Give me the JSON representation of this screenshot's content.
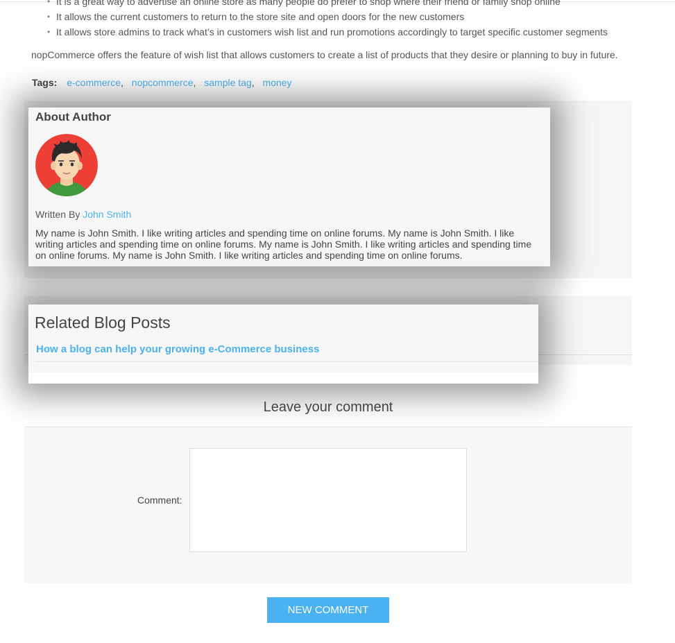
{
  "article": {
    "bullets": [
      "It is a great way to advertise an online store as many people do prefer to shop where their friend or family shop online",
      "It allows the current customers to return to the store site and open doors for the new customers",
      "It allows store admins to track what’s in customers wish list and run promotions accordingly to target specific customer segments"
    ],
    "intro": "nopCommerce offers the feature of wish list that allows customers to create a list of products that they desire or planning to buy in future."
  },
  "tags": {
    "label": "Tags:",
    "items": [
      "e-commerce",
      "nopcommerce",
      "sample tag",
      "money"
    ],
    "separator": ","
  },
  "author": {
    "title": "About Author",
    "written_by": "Written By",
    "name": "John Smith",
    "bio": "My name is John Smith. I like writing articles and spending time on online forums. My name is John Smith. I like writing articles and spending time on online forums. My name is John Smith. I like writing articles and spending time on online forums. My name is John Smith. I like writing articles and spending time on online forums.",
    "avatar_icon": "avatar-icon",
    "avatar_bg": "#ee3f36",
    "shirt_color": "#3f9a3f"
  },
  "related": {
    "title": "Related Blog Posts",
    "posts": [
      "How a blog can help your growing e-Commerce business"
    ]
  },
  "comment_form": {
    "title": "Leave your comment",
    "label": "Comment:",
    "value": "",
    "submit_label": "New comment"
  },
  "colors": {
    "accent": "#4ab2f1",
    "panel": "#f7f7f7"
  }
}
